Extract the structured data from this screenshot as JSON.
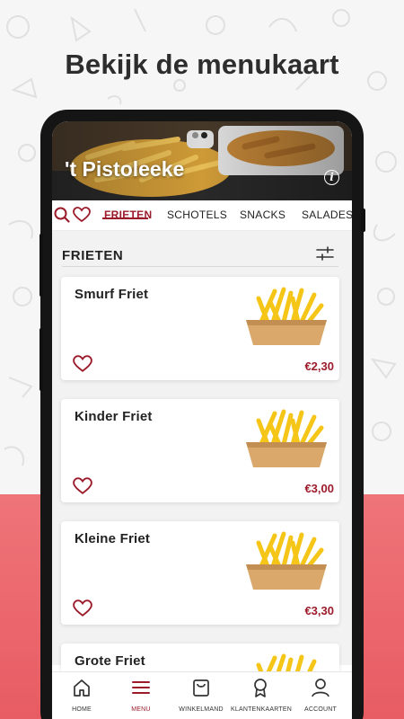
{
  "headline": "Bekijk de menukaart",
  "colors": {
    "accent": "#9b1b2a",
    "background_band": "#e85c63"
  },
  "restaurant": {
    "name": "'t Pistoleeke",
    "info_icon": "info-icon"
  },
  "tabs": [
    {
      "label": "FRIETEN",
      "active": true
    },
    {
      "label": "SCHOTELS",
      "active": false
    },
    {
      "label": "SNACKS",
      "active": false
    },
    {
      "label": "SALADES",
      "active": false
    }
  ],
  "section": {
    "title": "FRIETEN",
    "filter_icon": "sliders-icon"
  },
  "items": [
    {
      "name": "Smurf Friet",
      "price": "€2,30"
    },
    {
      "name": "Kinder Friet",
      "price": "€3,00"
    },
    {
      "name": "Kleine Friet",
      "price": "€3,30"
    },
    {
      "name": "Grote Friet",
      "price": ""
    }
  ],
  "bottom_nav": [
    {
      "label": "HOME",
      "icon": "home-icon",
      "active": false
    },
    {
      "label": "MENU",
      "icon": "menu-icon",
      "active": true
    },
    {
      "label": "WINKELMAND",
      "icon": "shopping-bag-icon",
      "active": false
    },
    {
      "label": "KLANTENKAARTEN",
      "icon": "award-icon",
      "active": false
    },
    {
      "label": "ACCOUNT",
      "icon": "user-icon",
      "active": false
    }
  ]
}
